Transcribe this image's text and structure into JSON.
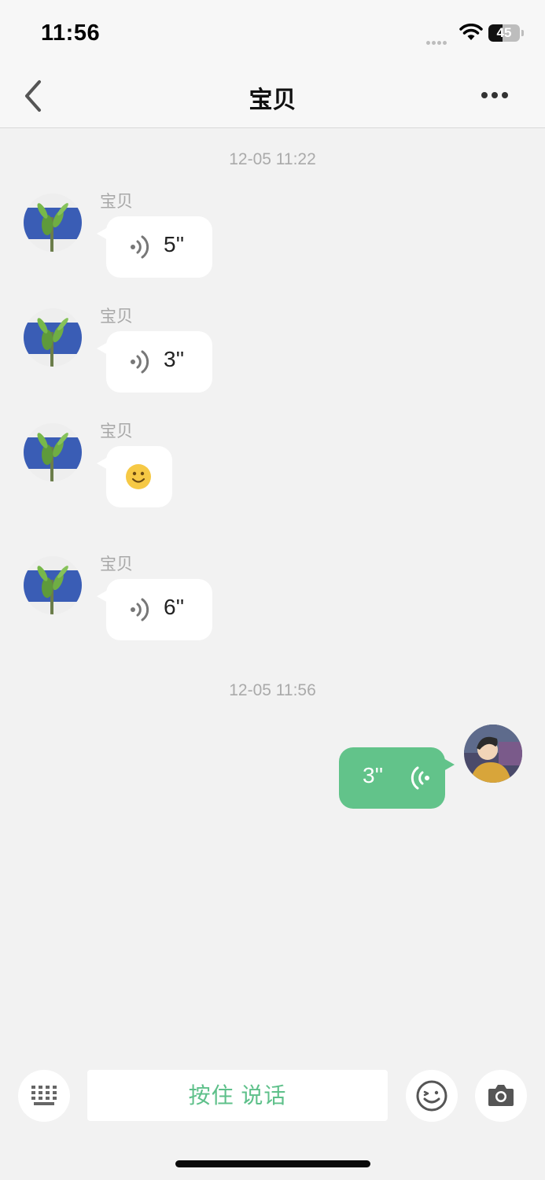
{
  "status": {
    "time": "11:56",
    "battery_level": 45,
    "battery_text": "45"
  },
  "nav": {
    "title": "宝贝"
  },
  "messages": [
    {
      "timestamp": "12-05 11:22"
    },
    {
      "sender": "宝贝",
      "type": "voice",
      "duration": "5''"
    },
    {
      "sender": "宝贝",
      "type": "voice",
      "duration": "3''"
    },
    {
      "sender": "宝贝",
      "type": "emoji",
      "emoji": "smile-emoji"
    },
    {
      "sender": "宝贝",
      "type": "voice",
      "duration": "6''"
    },
    {
      "timestamp": "12-05 11:56"
    },
    {
      "sender": "me",
      "type": "voice",
      "duration": "3''"
    }
  ],
  "input": {
    "hold_to_talk": "按住 说话"
  },
  "colors": {
    "accent": "#62c38a",
    "background": "#f2f2f2",
    "bubble_incoming": "#ffffff"
  }
}
